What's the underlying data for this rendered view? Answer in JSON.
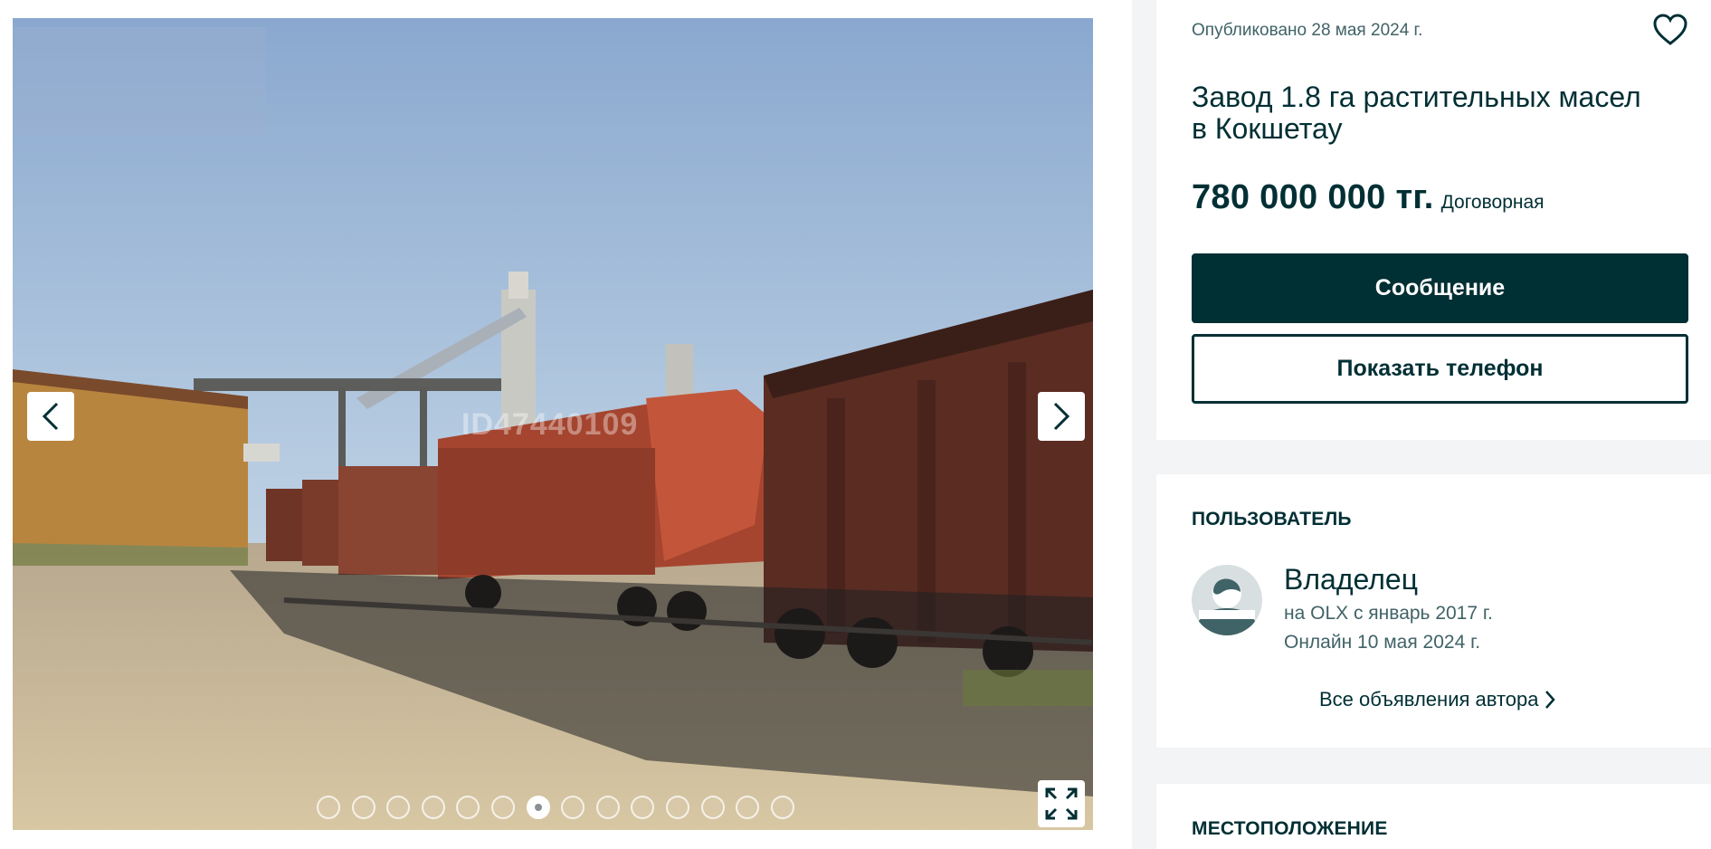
{
  "gallery": {
    "watermark": "ID47440109",
    "photo_alt": "railway-hopper-cars-at-elevator-photo",
    "slide_count": 14,
    "active_slide": 7
  },
  "listing": {
    "published": "Опубликовано 28 мая 2024 г.",
    "title": "Завод 1.8 га растительных масел в Кокшетау",
    "price": "780 000 000 тг.",
    "price_note": "Договорная",
    "message_button": "Сообщение",
    "phone_button": "Показать телефон"
  },
  "user": {
    "section_title": "ПОЛЬЗОВАТЕЛЬ",
    "name": "Владелец",
    "since": "на OLX с январь 2017 г.",
    "online": "Онлайн 10 мая 2024 г.",
    "all_ads_link": "Все объявления автора"
  },
  "location": {
    "section_title": "МЕСТОПОЛОЖЕНИЕ"
  },
  "colors": {
    "primary": "#002f34",
    "secondary_text": "#406367",
    "page_bg": "#f2f4f5"
  },
  "icons": [
    "chevron-left-icon",
    "chevron-right-icon",
    "expand-icon",
    "heart-icon",
    "chevron-right-small-icon"
  ]
}
